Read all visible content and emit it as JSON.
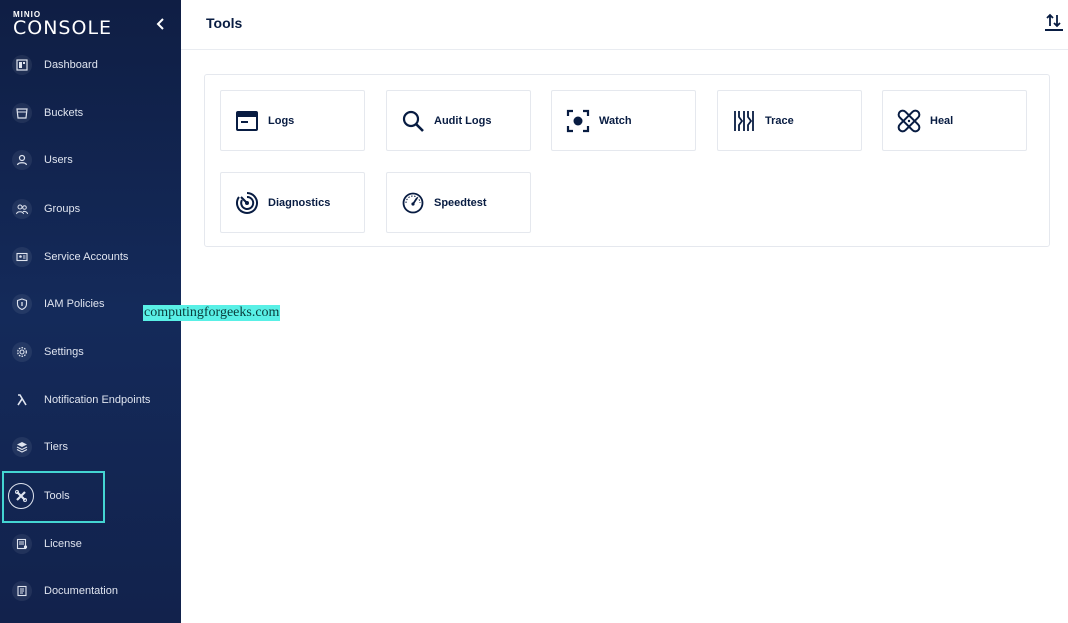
{
  "app": {
    "logo_small": "MINIO",
    "logo_big": "CONSOLE"
  },
  "sidebar": {
    "items": [
      {
        "label": "Dashboard",
        "icon": "dashboard-icon"
      },
      {
        "label": "Buckets",
        "icon": "bucket-icon"
      },
      {
        "label": "Users",
        "icon": "user-icon"
      },
      {
        "label": "Groups",
        "icon": "groups-icon"
      },
      {
        "label": "Service Accounts",
        "icon": "service-account-icon"
      },
      {
        "label": "IAM Policies",
        "icon": "shield-icon"
      },
      {
        "label": "Settings",
        "icon": "gear-icon"
      },
      {
        "label": "Notification Endpoints",
        "icon": "lambda-icon"
      },
      {
        "label": "Tiers",
        "icon": "tiers-icon"
      },
      {
        "label": "Tools",
        "icon": "tools-icon",
        "active": true
      },
      {
        "label": "License",
        "icon": "license-icon"
      },
      {
        "label": "Documentation",
        "icon": "documentation-icon"
      }
    ]
  },
  "header": {
    "title": "Tools"
  },
  "tools": [
    {
      "label": "Logs",
      "icon": "logs-icon"
    },
    {
      "label": "Audit Logs",
      "icon": "audit-logs-icon"
    },
    {
      "label": "Watch",
      "icon": "watch-icon"
    },
    {
      "label": "Trace",
      "icon": "trace-icon"
    },
    {
      "label": "Heal",
      "icon": "heal-icon"
    },
    {
      "label": "Diagnostics",
      "icon": "diagnostics-icon"
    },
    {
      "label": "Speedtest",
      "icon": "speedtest-icon"
    }
  ],
  "watermark": "computingforgeeks.com",
  "colors": {
    "sidebar_bg": "#0f1e44",
    "accent": "#44d5d2",
    "text_dark": "#081c42"
  }
}
